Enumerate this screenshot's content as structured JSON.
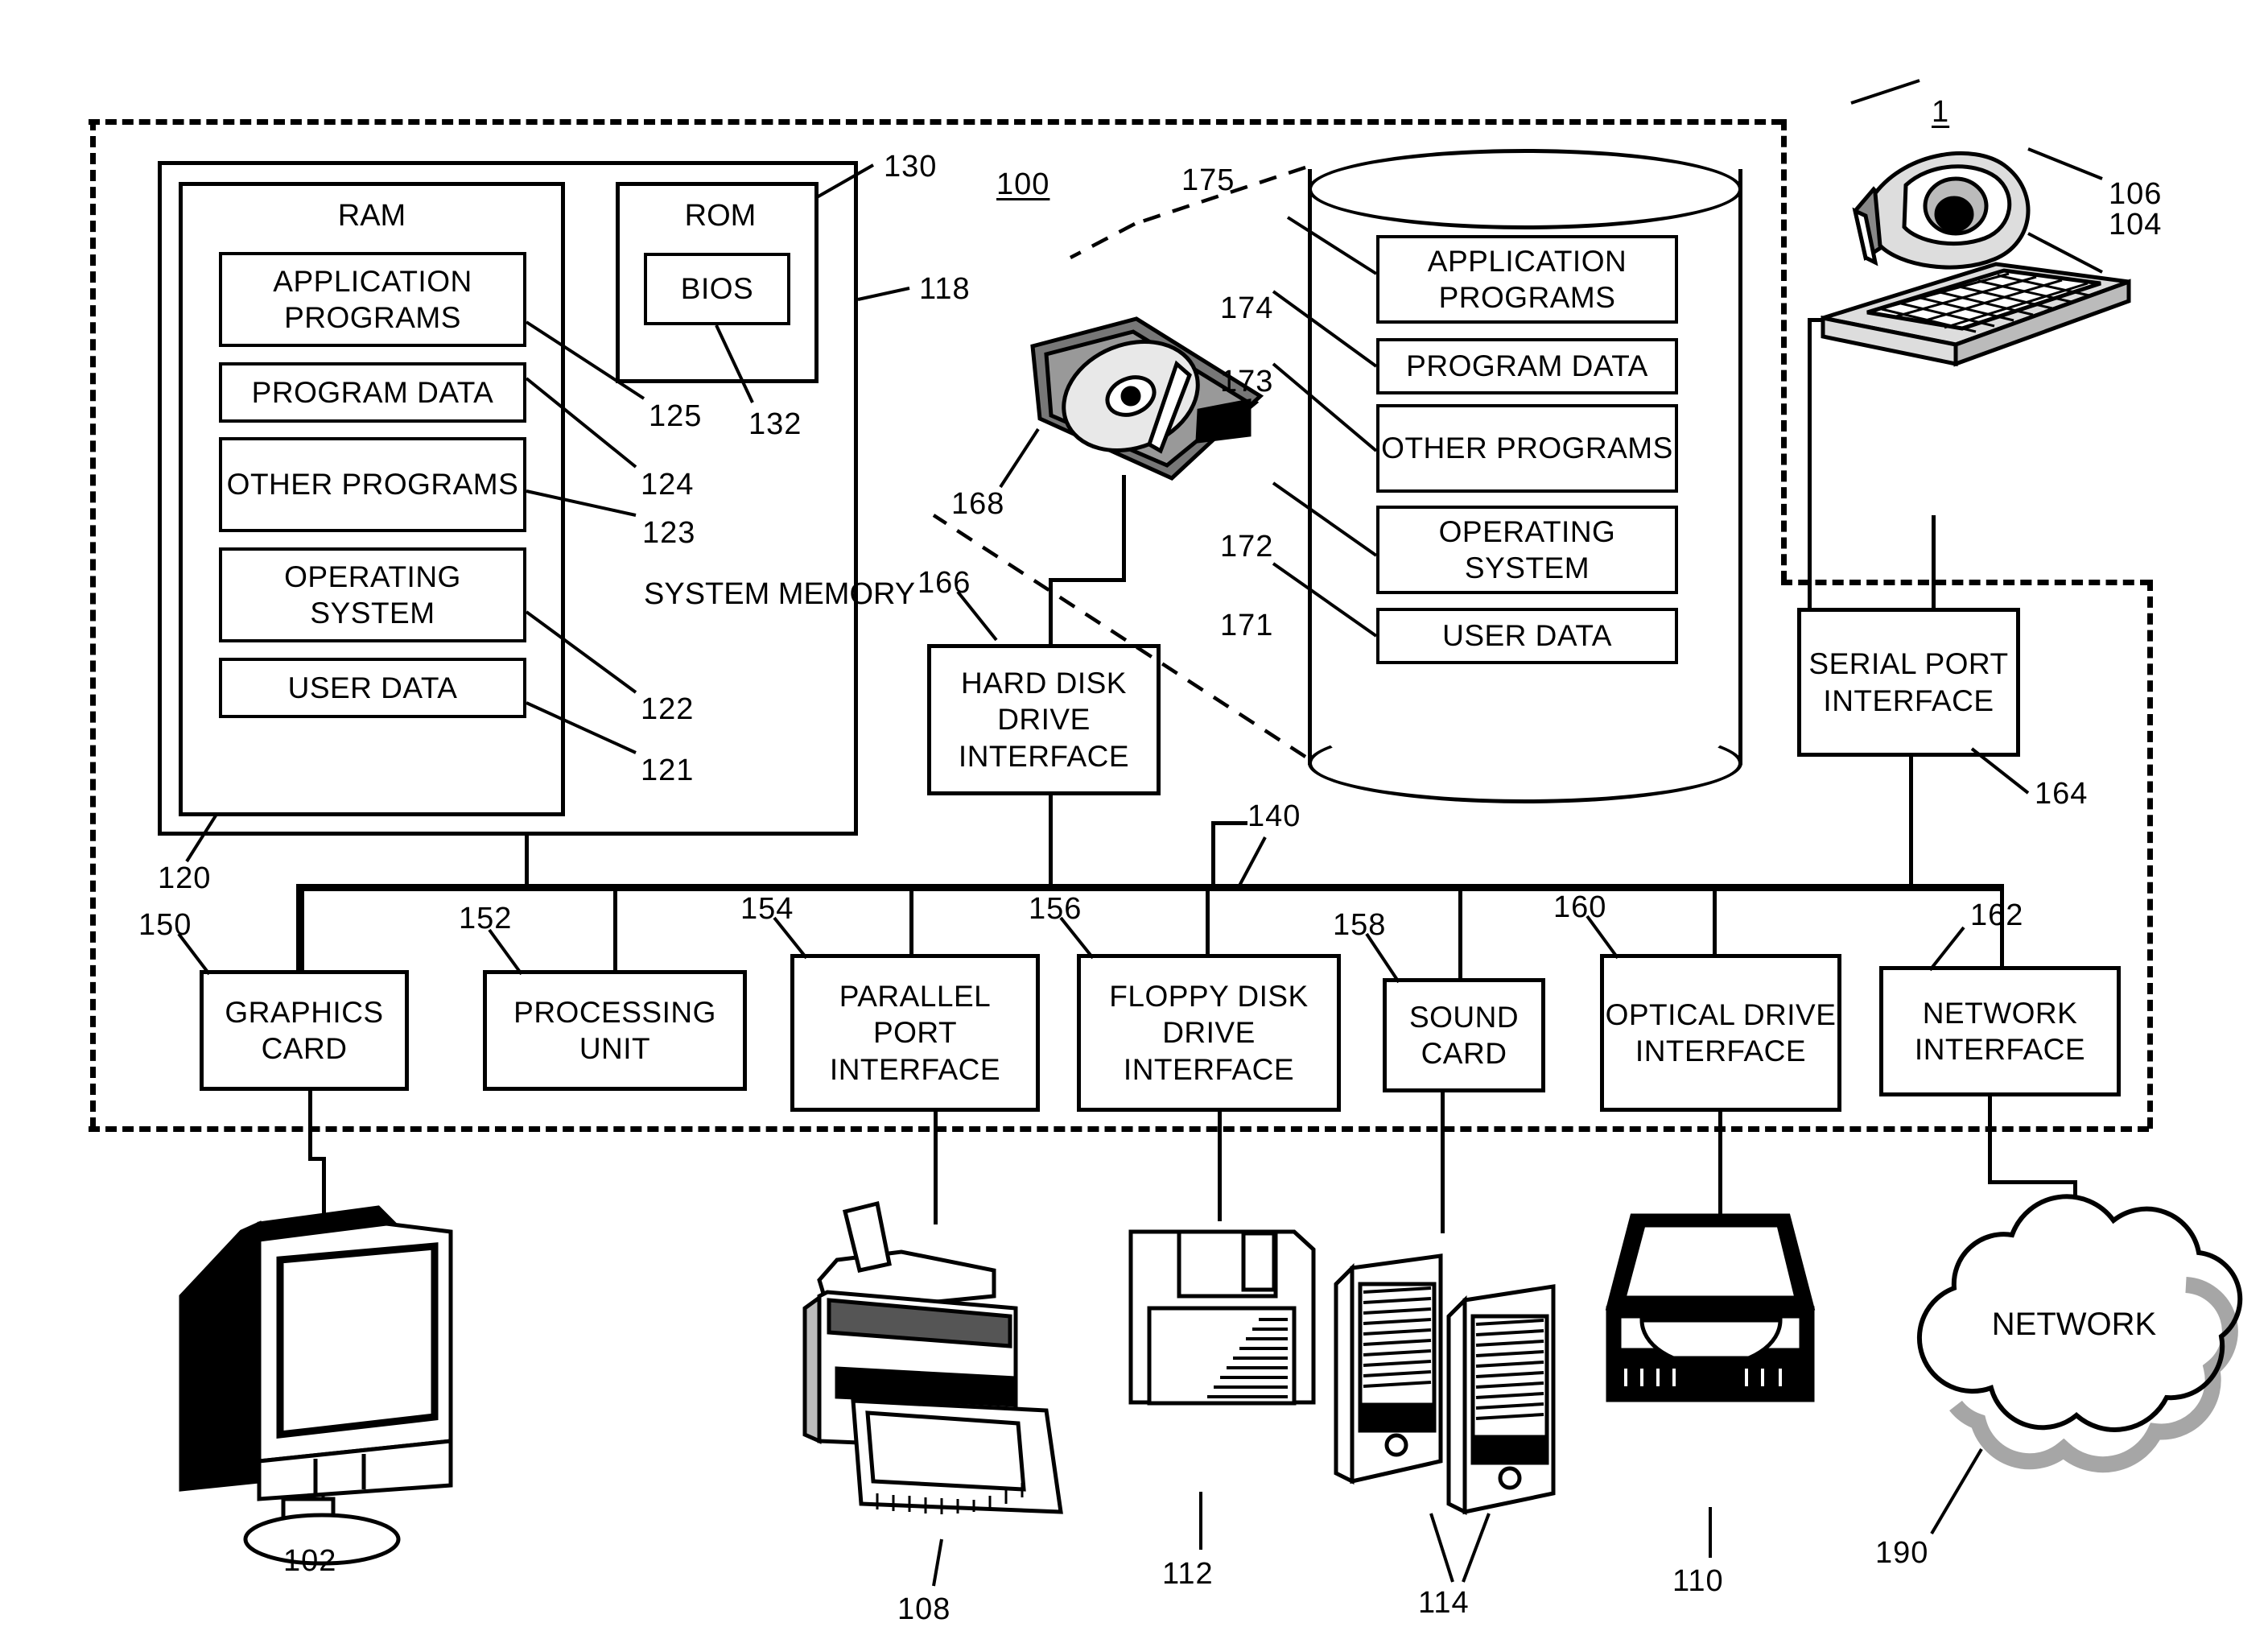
{
  "figure": {
    "figure_number": "1",
    "system_label": "100",
    "bus_label": "140"
  },
  "system_memory": {
    "title": "SYSTEM MEMORY",
    "ref": "118",
    "ram": {
      "label": "RAM",
      "ref": "120",
      "items": [
        {
          "label": "APPLICATION PROGRAMS",
          "ref": "125"
        },
        {
          "label": "PROGRAM DATA",
          "ref": "124"
        },
        {
          "label": "OTHER PROGRAMS",
          "ref": "123"
        },
        {
          "label": "OPERATING SYSTEM",
          "ref": "122"
        },
        {
          "label": "USER DATA",
          "ref": "121"
        }
      ]
    },
    "rom": {
      "label": "ROM",
      "ref": "130",
      "bios": {
        "label": "BIOS",
        "ref": "132"
      }
    }
  },
  "mass_storage": {
    "ref": "175",
    "hard_disk_ref": "168",
    "items": [
      {
        "label": "APPLICATION PROGRAMS",
        "ref": "175"
      },
      {
        "label": "PROGRAM DATA",
        "ref": "174"
      },
      {
        "label": "OTHER PROGRAMS",
        "ref": "173"
      },
      {
        "label": "OPERATING SYSTEM",
        "ref": "172"
      },
      {
        "label": "USER DATA",
        "ref": "171"
      }
    ]
  },
  "interfaces": {
    "hard_disk_drive_interface": {
      "label": "HARD DISK DRIVE INTERFACE",
      "ref": "166"
    },
    "serial_port_interface": {
      "label": "SERIAL PORT INTERFACE",
      "ref": "164"
    },
    "bottom_row": [
      {
        "label": "GRAPHICS CARD",
        "ref": "150"
      },
      {
        "label": "PROCESSING UNIT",
        "ref": "152"
      },
      {
        "label": "PARALLEL PORT INTERFACE",
        "ref": "154"
      },
      {
        "label": "FLOPPY DISK DRIVE INTERFACE",
        "ref": "156"
      },
      {
        "label": "SOUND CARD",
        "ref": "158"
      },
      {
        "label": "OPTICAL DRIVE INTERFACE",
        "ref": "160"
      },
      {
        "label": "NETWORK INTERFACE",
        "ref": "162"
      }
    ]
  },
  "peripherals": {
    "monitor": {
      "ref": "102"
    },
    "keyboard": {
      "ref": "104"
    },
    "mouse": {
      "ref": "106"
    },
    "printer": {
      "ref": "108"
    },
    "optical_disc_drive": {
      "ref": "110"
    },
    "floppy_disk": {
      "ref": "112"
    },
    "speakers": {
      "ref": "114"
    },
    "network": {
      "label": "NETWORK",
      "ref": "190"
    }
  },
  "colors": {
    "ink": "#000000",
    "paper": "#ffffff"
  }
}
